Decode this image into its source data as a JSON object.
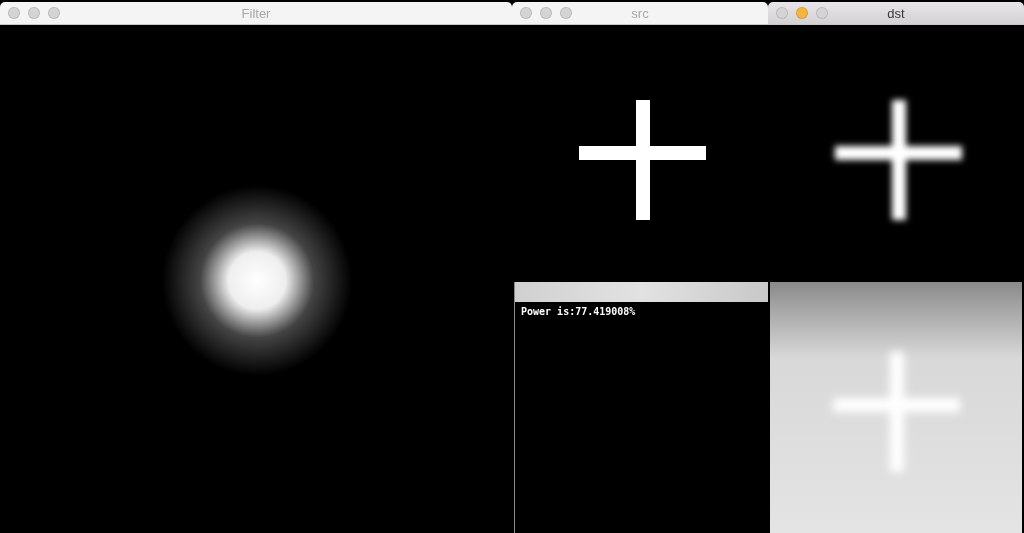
{
  "windows": [
    {
      "title": "Filter",
      "active": false,
      "kind": "glow"
    },
    {
      "title": "src",
      "active": false,
      "kind": "cross"
    },
    {
      "title": "dst",
      "active": true,
      "kind": "blurred"
    }
  ],
  "console": {
    "text": "Power is:77.419008%"
  },
  "backdrop": {
    "kind": "faded"
  }
}
